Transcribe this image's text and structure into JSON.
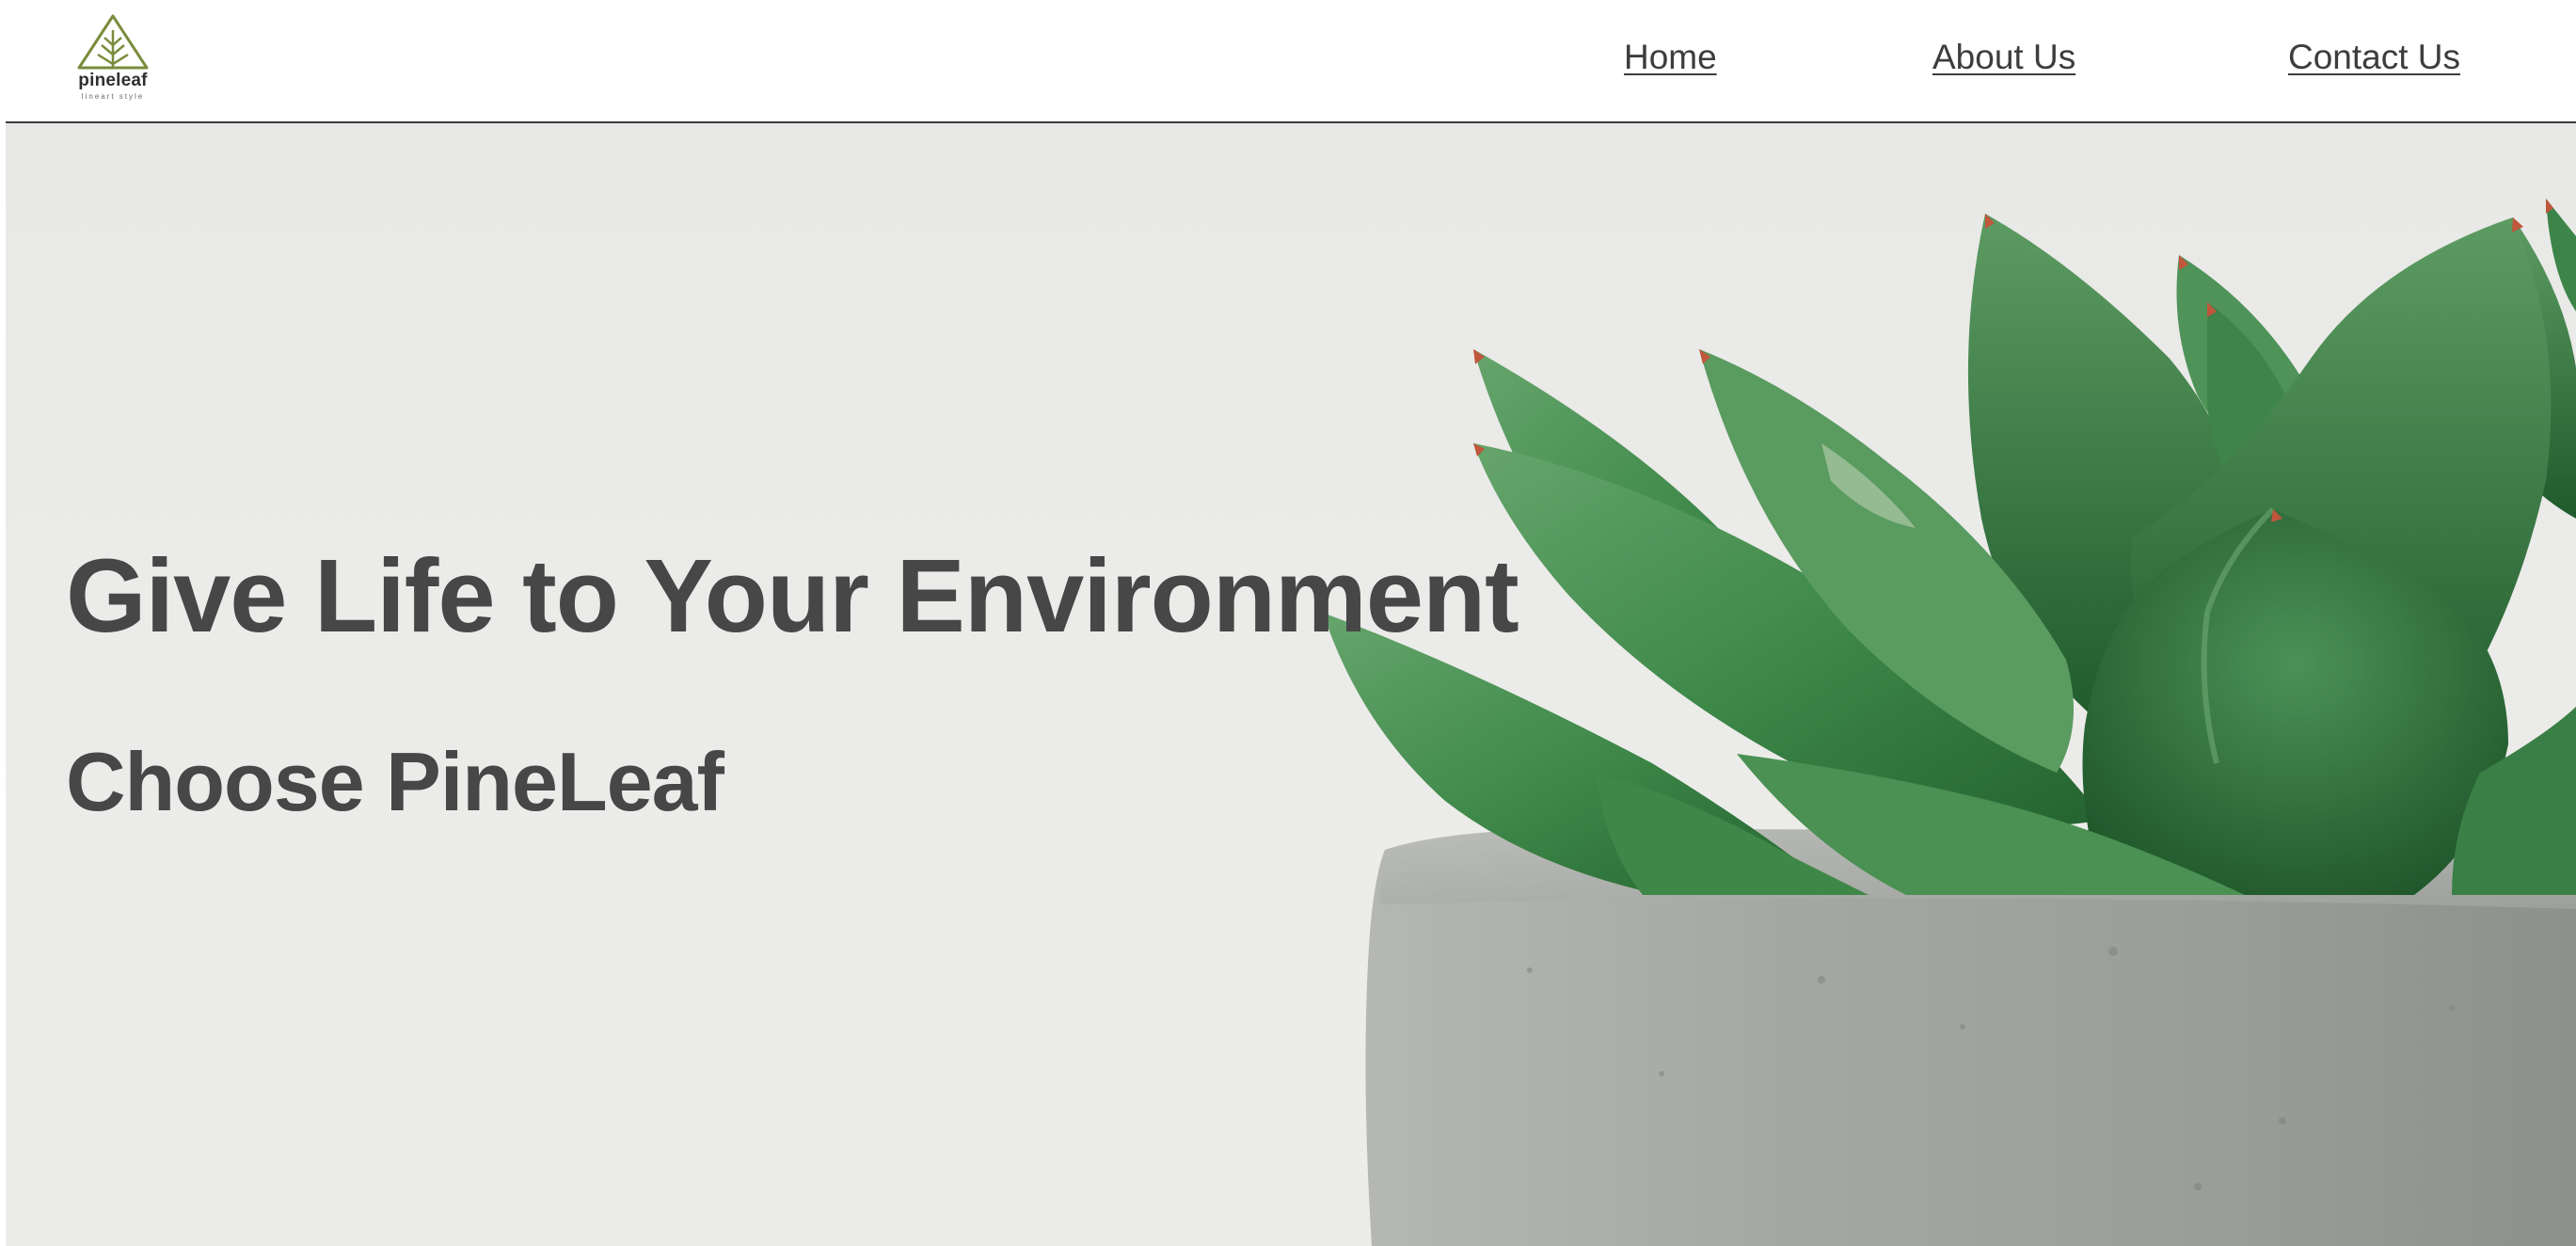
{
  "brand": {
    "name": "pineleaf",
    "tagline": "lineart style",
    "logo_icon": "pine-tree-triangle-icon",
    "logo_color": "#7a8c3c"
  },
  "nav": {
    "items": [
      {
        "label": "Home"
      },
      {
        "label": "About Us"
      },
      {
        "label": "Contact Us"
      }
    ]
  },
  "hero": {
    "title": "Give Life to Your Environment",
    "subtitle": "Choose PineLeaf",
    "image": "succulent-in-concrete-pot",
    "text_color": "#474747",
    "background_color": "#e9e9e7"
  },
  "colors": {
    "leaf_green": "#3f8a4a",
    "leaf_dark": "#1f5a2c",
    "pot_gray": "#a7aaa6",
    "header_border": "#3a3a3a"
  }
}
